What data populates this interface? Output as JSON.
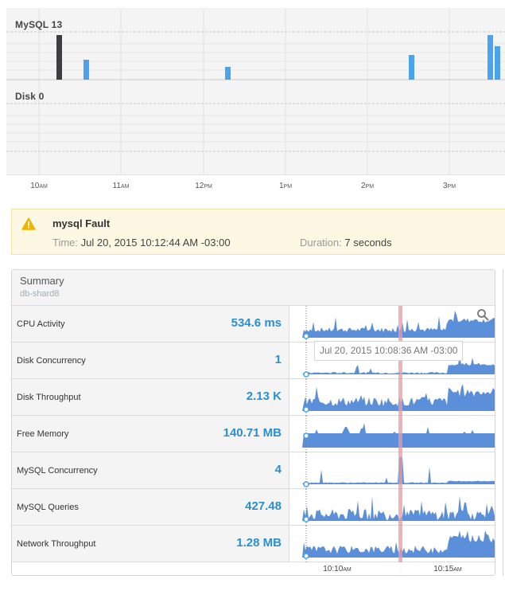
{
  "timeline": {
    "lanes": [
      {
        "label": "MySQL 13"
      },
      {
        "label": "Disk 0"
      }
    ],
    "ticks": [
      {
        "hour": "10",
        "ampm": "AM"
      },
      {
        "hour": "11",
        "ampm": "AM"
      },
      {
        "hour": "12",
        "ampm": "PM"
      },
      {
        "hour": "1",
        "ampm": "PM"
      },
      {
        "hour": "2",
        "ampm": "PM"
      },
      {
        "hour": "3",
        "ampm": "PM"
      }
    ],
    "colors": {
      "event": "#4aa3ec",
      "selected_event": "#3a3f44"
    }
  },
  "alert": {
    "icon": "warning-icon",
    "title": "mysql Fault",
    "time_label": "Time:",
    "time_value": "Jul 20, 2015 10:12:44 AM -03:00",
    "duration_label": "Duration:",
    "duration_value": "7 seconds",
    "color": "#fdf8e3"
  },
  "summary": {
    "title": "Summary",
    "subtitle": "db-shard8",
    "search_icon": "search-icon",
    "tooltip": "Jul 20, 2015 10:08:36 AM -03:00",
    "metrics": [
      {
        "label": "CPU Activity",
        "value": "534.6 ms"
      },
      {
        "label": "Disk Concurrency",
        "value": "1"
      },
      {
        "label": "Disk Throughput",
        "value": "2.13 K"
      },
      {
        "label": "Free Memory",
        "value": "140.71 MB"
      },
      {
        "label": "MySQL Concurrency",
        "value": "4"
      },
      {
        "label": "MySQL Queries",
        "value": "427.48"
      },
      {
        "label": "Network Throughput",
        "value": "1.28 MB"
      }
    ],
    "axis": [
      {
        "time": "10:10",
        "ampm": "AM"
      },
      {
        "time": "10:15",
        "ampm": "AM"
      }
    ],
    "colors": {
      "value": "#2a8fd0",
      "spark": "#5b8fd9",
      "fault_marker": "#e89aa3"
    }
  }
}
